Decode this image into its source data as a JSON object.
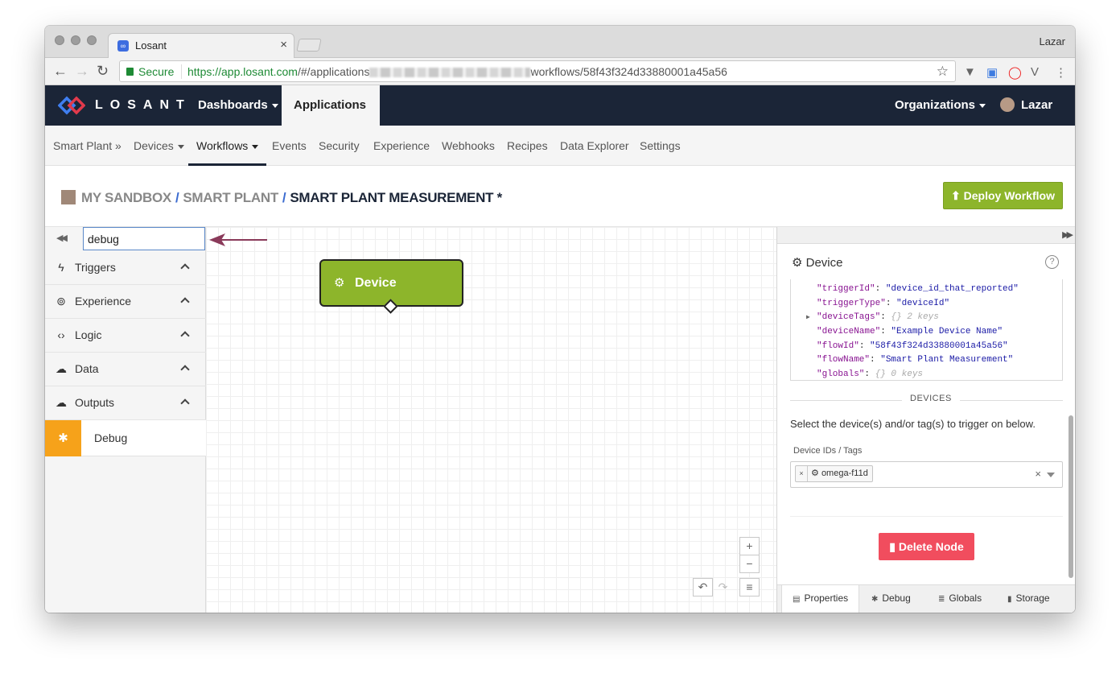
{
  "browser": {
    "tab_title": "Losant",
    "tab_favicon": "losant-favicon-icon",
    "profile": "Lazar",
    "secure_label": "Secure",
    "url_host": "https://app.losant.com",
    "url_path_start": "/#/applications",
    "url_path_end": "workflows/58f43f324d33880001a45a56"
  },
  "topnav": {
    "logo_text": "LOSANT",
    "dashboards": "Dashboards",
    "applications": "Applications",
    "organizations": "Organizations",
    "user": "Lazar"
  },
  "subnav": {
    "items": [
      "Smart Plant »",
      "Devices",
      "Workflows",
      "Events",
      "Security",
      "Experience",
      "Webhooks",
      "Recipes",
      "Data Explorer",
      "Settings"
    ],
    "active": "Workflows"
  },
  "header": {
    "crumb_sandbox": "MY SANDBOX",
    "crumb_app": "SMART PLANT",
    "crumb_workflow": "SMART PLANT MEASUREMENT *",
    "deploy_label": "Deploy Workflow",
    "accent_color": "#8db52b"
  },
  "palette": {
    "search_value": "debug",
    "categories": [
      "Triggers",
      "Experience",
      "Logic",
      "Data",
      "Outputs"
    ],
    "result_node": "Debug",
    "result_color": "#f6a21a"
  },
  "canvas": {
    "node_label": "Device",
    "node_color": "#8db52b",
    "zoom_in": "+",
    "zoom_out": "−"
  },
  "panel": {
    "node_title": "Device",
    "json_rows": [
      {
        "key": "\"triggerId\"",
        "val": "\"device_id_that_reported\"",
        "kind": "str"
      },
      {
        "key": "\"triggerType\"",
        "val": "\"deviceId\"",
        "kind": "str"
      },
      {
        "key": "\"deviceTags\"",
        "val": "{}  2 keys",
        "kind": "meta"
      },
      {
        "key": "\"deviceName\"",
        "val": "\"Example Device Name\"",
        "kind": "str"
      },
      {
        "key": "\"flowId\"",
        "val": "\"58f43f324d33880001a45a56\"",
        "kind": "str"
      },
      {
        "key": "\"flowName\"",
        "val": "\"Smart Plant Measurement\"",
        "kind": "str"
      },
      {
        "key": "\"globals\"",
        "val": "{}  0 keys",
        "kind": "meta"
      }
    ],
    "devices_heading": "DEVICES",
    "devices_desc": "Select the device(s) and/or tag(s) to trigger on below.",
    "ids_label": "Device IDs / Tags",
    "selected_tag": "omega-f11d",
    "delete_label": "Delete Node",
    "delete_color": "#f14d5e",
    "tabs": [
      "Properties",
      "Debug",
      "Globals",
      "Storage"
    ],
    "active_tab": "Properties"
  }
}
